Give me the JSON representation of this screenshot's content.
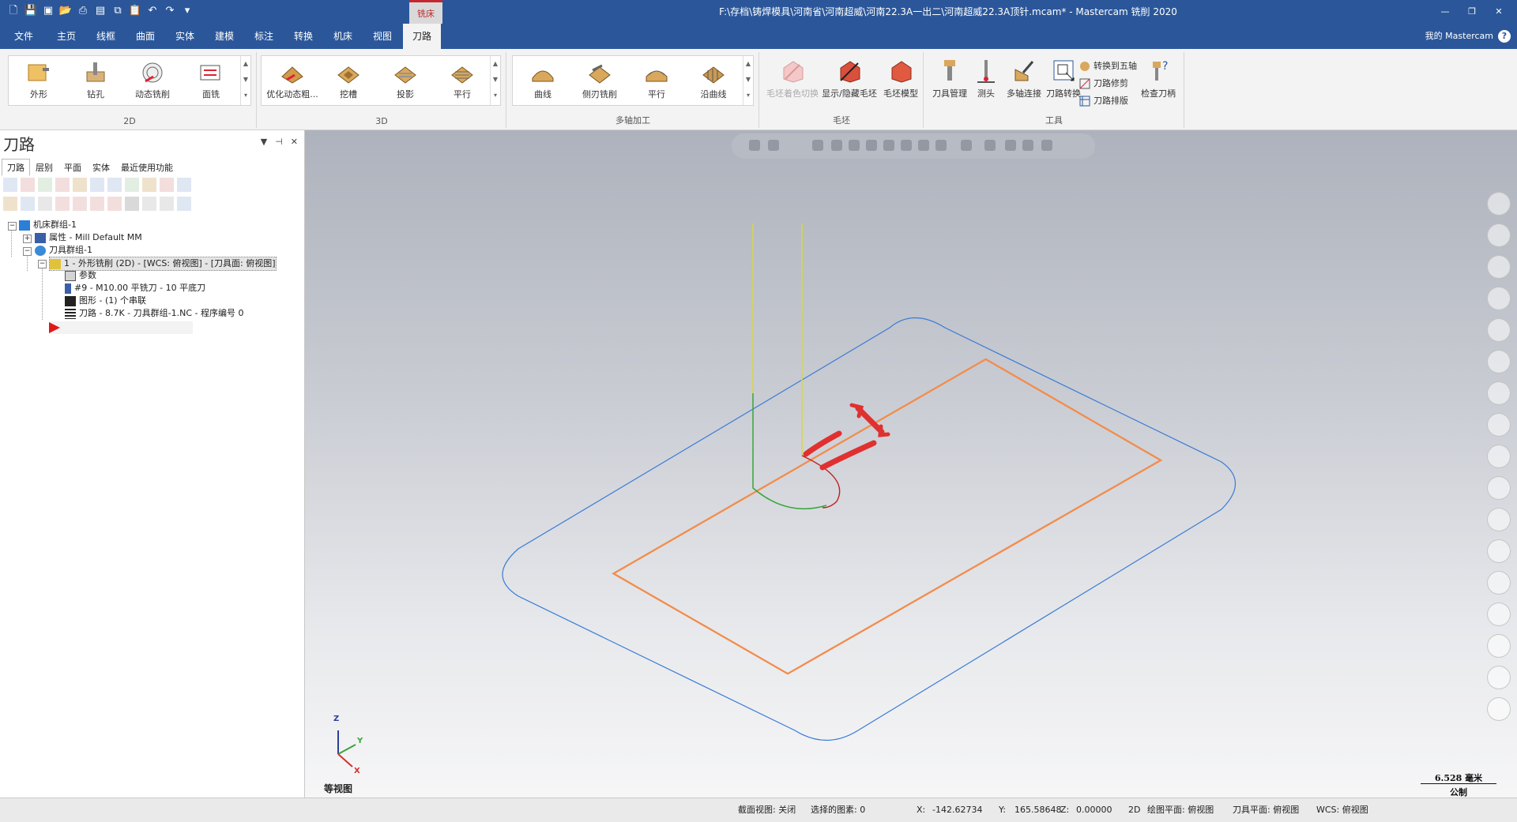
{
  "titlebar": {
    "title": "F:\\存档\\铸焊模具\\河南省\\河南超威\\河南22.3A一出二\\河南超威22.3A顶针.mcam* - Mastercam 铣削 2020",
    "context_tab": "铣床",
    "quick_access_icons": [
      "new-file-icon",
      "save-icon",
      "save-as-icon",
      "open-icon",
      "print-icon",
      "print-preview-icon",
      "copy-icon",
      "paste-icon",
      "undo-icon",
      "redo-icon",
      "customize-icon"
    ]
  },
  "menubar": {
    "tabs": [
      "文件",
      "主页",
      "线框",
      "曲面",
      "实体",
      "建模",
      "标注",
      "转换",
      "机床",
      "视图",
      "刀路"
    ],
    "active_tab": "刀路",
    "account": "我的 Mastercam"
  },
  "ribbon": {
    "groups": [
      "2D",
      "3D",
      "多轴加工",
      "毛坯",
      "工具"
    ],
    "g2d_items": [
      "外形",
      "钻孔",
      "动态铣削",
      "面铣"
    ],
    "g3d_items": [
      "优化动态粗...",
      "挖槽",
      "投影",
      "平行"
    ],
    "gmulti_items": [
      "曲线",
      "侧刃铣削",
      "平行",
      "沿曲线"
    ],
    "stock_items": [
      "毛坯着色切换",
      "显示/隐藏毛坯",
      "毛坯模型"
    ],
    "tool_items": [
      "刀具管理",
      "测头",
      "多轴连接",
      "刀路转换",
      "检查刀柄"
    ],
    "tool_small_items": [
      "转换到五轴",
      "刀路修剪",
      "刀路排版"
    ]
  },
  "panel": {
    "title": "刀路",
    "subtabs": [
      "刀路",
      "层别",
      "平面",
      "实体",
      "最近使用功能"
    ],
    "active_subtab": "刀路",
    "tree": [
      {
        "label": "机床群组-1",
        "icon": "machine-group-icon"
      },
      {
        "label": "属性 - Mill Default MM",
        "icon": "properties-icon"
      },
      {
        "label": "刀具群组-1",
        "icon": "toolgroup-icon"
      },
      {
        "label": "1 - 外形铣削 (2D) - [WCS: 俯视图] - [刀具面: 俯视图]",
        "icon": "operation-icon"
      },
      {
        "label": "参数",
        "icon": "folder-icon"
      },
      {
        "label": "#9 - M10.00 平铣刀 - 10 平底刀",
        "icon": "tool-icon"
      },
      {
        "label": "图形 - (1) 个串联",
        "icon": "geometry-icon"
      },
      {
        "label": "刀路 - 8.7K - 刀具群组-1.NC - 程序编号 0",
        "icon": "toolpath-icon"
      }
    ]
  },
  "viewport": {
    "view_name": "等视图",
    "axes": {
      "z": "Z",
      "y": "Y",
      "x": "X"
    },
    "scale_value": "6.528 毫米",
    "scale_unit": "公制",
    "colors": {
      "outer_contour": "#3a7bd5",
      "inner_contour": "#f28c4b",
      "lead_line": "#d8d83c",
      "lead_arc": "#3aa43a",
      "tool_marker": "#e03030"
    }
  },
  "statusbar": {
    "section_view": "截面视图: 关闭",
    "selected": "选择的图素: 0",
    "x_label": "X:",
    "x_value": "-142.62734",
    "y_label": "Y:",
    "y_value": "165.58648",
    "z_label": "Z:",
    "z_value": "0.00000",
    "mode": "2D",
    "draw_plane": "绘图平面: 俯视图",
    "tool_plane": "刀具平面: 俯视图",
    "wcs": "WCS: 俯视图"
  }
}
